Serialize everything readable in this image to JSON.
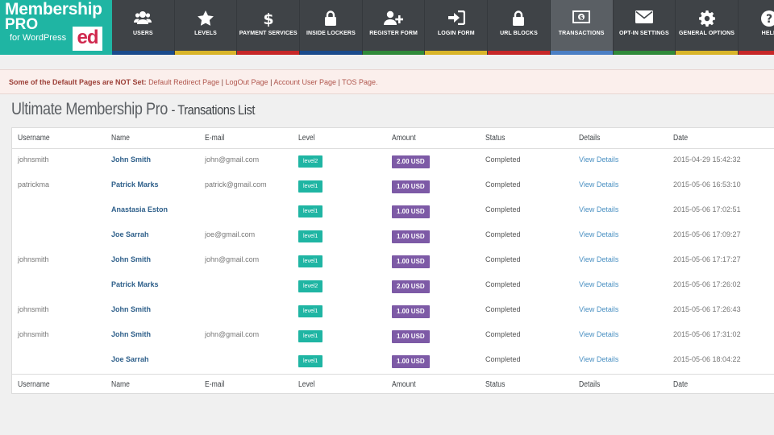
{
  "logo": {
    "line1": "Membership",
    "line2": "PRO",
    "line3": "for WordPress",
    "badge": "ed"
  },
  "nav": [
    {
      "label": "USERS",
      "icon": "users-icon",
      "stripe": "#1a4b8c"
    },
    {
      "label": "LEVELS",
      "icon": "star-icon",
      "stripe": "#d8b52a"
    },
    {
      "label": "PAYMENT SERVICES",
      "icon": "dollar-icon",
      "stripe": "#c62828"
    },
    {
      "label": "INSIDE LOCKERS",
      "icon": "lock-icon",
      "stripe": "#1a4b8c"
    },
    {
      "label": "REGISTER FORM",
      "icon": "add-user-icon",
      "stripe": "#2f8a3a"
    },
    {
      "label": "LOGIN FORM",
      "icon": "sign-in-icon",
      "stripe": "#d8b52a"
    },
    {
      "label": "URL BLOCKS",
      "icon": "lock-icon",
      "stripe": "#c62828"
    },
    {
      "label": "TRANSACTIONS",
      "icon": "money-icon",
      "stripe": "#4a7fc4"
    },
    {
      "label": "OPT-IN SETTINGS",
      "icon": "envelope-icon",
      "stripe": "#2f8a3a"
    },
    {
      "label": "GENERAL OPTIONS",
      "icon": "gear-icon",
      "stripe": "#d8b52a"
    },
    {
      "label": "HELP",
      "icon": "help-icon",
      "stripe": "#c62828"
    }
  ],
  "notice": {
    "lead": "Some of the Default Pages are NOT Set:",
    "links": [
      "Default Redirect Page",
      "LogOut Page",
      "Account User Page",
      "TOS Page."
    ],
    "separator": "|"
  },
  "title": {
    "main": "Ultimate Membership Pro",
    "sub": "- Transations List"
  },
  "columns": [
    "Username",
    "Name",
    "E-mail",
    "Level",
    "Amount",
    "Status",
    "Details",
    "Date"
  ],
  "rows": [
    {
      "username": "johnsmith",
      "name": "John Smith",
      "email": "john@gmail.com",
      "level": "level2",
      "amount": "2.00 USD",
      "status": "Completed",
      "details": "View Details",
      "date": "2015-04-29 15:42:32"
    },
    {
      "username": "patrickma",
      "name": "Patrick Marks",
      "email": "patrick@gmail.com",
      "level": "level1",
      "amount": "1.00 USD",
      "status": "Completed",
      "details": "View Details",
      "date": "2015-05-06 16:53:10"
    },
    {
      "username": "",
      "name": "Anastasia Eston",
      "email": "",
      "level": "level1",
      "amount": "1.00 USD",
      "status": "Completed",
      "details": "View Details",
      "date": "2015-05-06 17:02:51"
    },
    {
      "username": "",
      "name": "Joe Sarrah",
      "email": "joe@gmail.com",
      "level": "level1",
      "amount": "1.00 USD",
      "status": "Completed",
      "details": "View Details",
      "date": "2015-05-06 17:09:27"
    },
    {
      "username": "johnsmith",
      "name": "John Smith",
      "email": "john@gmail.com",
      "level": "level1",
      "amount": "1.00 USD",
      "status": "Completed",
      "details": "View Details",
      "date": "2015-05-06 17:17:27"
    },
    {
      "username": "",
      "name": "Patrick Marks",
      "email": "",
      "level": "level2",
      "amount": "2.00 USD",
      "status": "Completed",
      "details": "View Details",
      "date": "2015-05-06 17:26:02"
    },
    {
      "username": "johnsmith",
      "name": "John Smith",
      "email": "",
      "level": "level1",
      "amount": "1.00 USD",
      "status": "Completed",
      "details": "View Details",
      "date": "2015-05-06 17:26:43"
    },
    {
      "username": "johnsmith",
      "name": "John Smith",
      "email": "john@gmail.com",
      "level": "level1",
      "amount": "1.00 USD",
      "status": "Completed",
      "details": "View Details",
      "date": "2015-05-06 17:31:02"
    },
    {
      "username": "",
      "name": "Joe Sarrah",
      "email": "",
      "level": "level1",
      "amount": "1.00 USD",
      "status": "Completed",
      "details": "View Details",
      "date": "2015-05-06 18:04:22"
    }
  ]
}
